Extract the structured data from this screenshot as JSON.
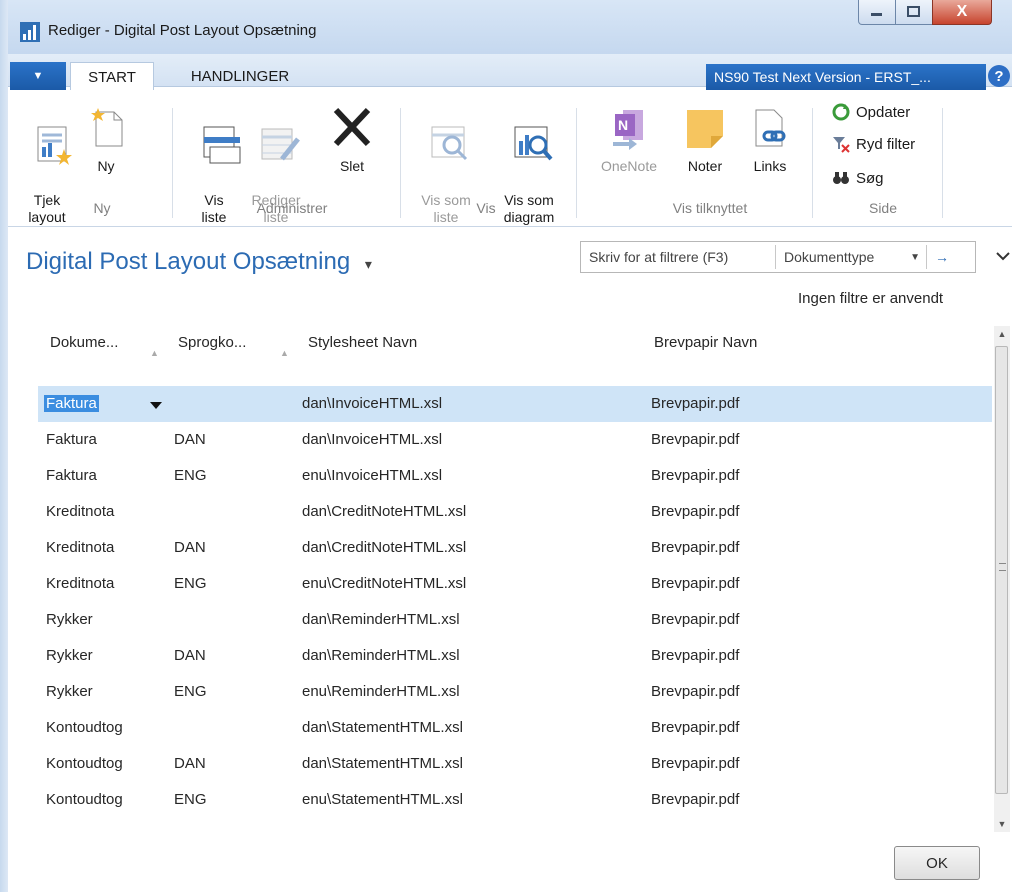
{
  "window": {
    "title": "Rediger - Digital Post Layout Opsætning",
    "close_symbol": "X"
  },
  "tabs": [
    {
      "label": "START",
      "active": true
    },
    {
      "label": "HANDLINGER",
      "active": false
    }
  ],
  "menu_arrow": "▼",
  "company": "NS90 Test Next Version - ERST_...",
  "help_symbol": "?",
  "ribbon": {
    "ny": {
      "tjek_layout": "Tjek\nlayout",
      "ny": "Ny",
      "group": "Ny"
    },
    "administrer": {
      "vis_liste": "Vis\nliste",
      "rediger_liste": "Rediger\nliste",
      "slet": "Slet",
      "group": "Administrer"
    },
    "vis": {
      "vis_som_liste": "Vis som\nliste",
      "vis_som_diagram": "Vis som\ndiagram",
      "group": "Vis"
    },
    "tilknyttet": {
      "onenote": "OneNote",
      "noter": "Noter",
      "links": "Links",
      "group": "Vis tilknyttet"
    },
    "side": {
      "opdater": "Opdater",
      "ryd_filter": "Ryd filter",
      "sog": "Søg",
      "group": "Side"
    }
  },
  "page_title": "Digital Post Layout Opsætning",
  "title_dropdown": "▾",
  "filter": {
    "placeholder": "Skriv for at filtrere (F3)",
    "field": "Dokumenttype",
    "go": "→"
  },
  "no_filters": "Ingen filtre er anvendt",
  "columns": [
    "Dokume...",
    "Sprogko...",
    "Stylesheet Navn",
    "Brevpapir Navn"
  ],
  "rows": [
    {
      "doc": "Faktura",
      "lang": "",
      "stylesheet": "dan\\InvoiceHTML.xsl",
      "paper": "Brevpapir.pdf"
    },
    {
      "doc": "Faktura",
      "lang": "DAN",
      "stylesheet": "dan\\InvoiceHTML.xsl",
      "paper": "Brevpapir.pdf"
    },
    {
      "doc": "Faktura",
      "lang": "ENG",
      "stylesheet": "enu\\InvoiceHTML.xsl",
      "paper": "Brevpapir.pdf"
    },
    {
      "doc": "Kreditnota",
      "lang": "",
      "stylesheet": "dan\\CreditNoteHTML.xsl",
      "paper": "Brevpapir.pdf"
    },
    {
      "doc": "Kreditnota",
      "lang": "DAN",
      "stylesheet": "dan\\CreditNoteHTML.xsl",
      "paper": "Brevpapir.pdf"
    },
    {
      "doc": "Kreditnota",
      "lang": "ENG",
      "stylesheet": "enu\\CreditNoteHTML.xsl",
      "paper": "Brevpapir.pdf"
    },
    {
      "doc": "Rykker",
      "lang": "",
      "stylesheet": "dan\\ReminderHTML.xsl",
      "paper": "Brevpapir.pdf"
    },
    {
      "doc": "Rykker",
      "lang": "DAN",
      "stylesheet": "dan\\ReminderHTML.xsl",
      "paper": "Brevpapir.pdf"
    },
    {
      "doc": "Rykker",
      "lang": "ENG",
      "stylesheet": "enu\\ReminderHTML.xsl",
      "paper": "Brevpapir.pdf"
    },
    {
      "doc": "Kontoudtog",
      "lang": "",
      "stylesheet": "dan\\StatementHTML.xsl",
      "paper": "Brevpapir.pdf"
    },
    {
      "doc": "Kontoudtog",
      "lang": "DAN",
      "stylesheet": "dan\\StatementHTML.xsl",
      "paper": "Brevpapir.pdf"
    },
    {
      "doc": "Kontoudtog",
      "lang": "ENG",
      "stylesheet": "enu\\StatementHTML.xsl",
      "paper": "Brevpapir.pdf"
    }
  ],
  "ok_label": "OK",
  "colors": {
    "title_blue": "#2c6bb3",
    "selection": "#cfe4f7",
    "accent": "#1b5aa7"
  }
}
